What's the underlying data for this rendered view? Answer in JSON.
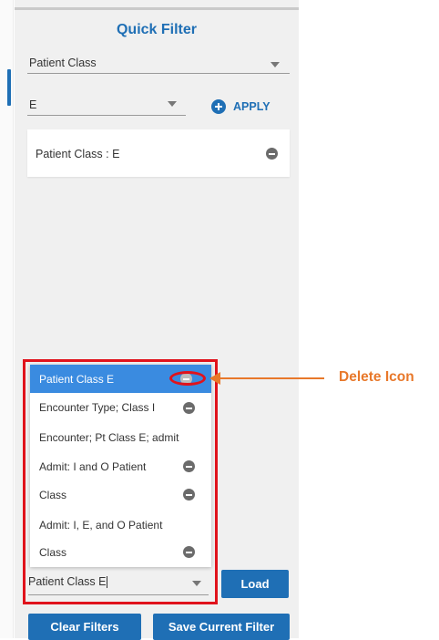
{
  "panel": {
    "title": "Quick Filter",
    "field_select": {
      "value": "Patient Class"
    },
    "value_select": {
      "value": "E"
    },
    "apply_label": "APPLY",
    "active_filters": [
      {
        "text": "Patient Class : E",
        "icon": "minus-circle-icon"
      }
    ]
  },
  "saved_filters": {
    "items": [
      {
        "label": "Patient Class E",
        "selected": true,
        "has_delete": true
      },
      {
        "label": "Encounter Type; Class I",
        "selected": false,
        "has_delete": true
      },
      {
        "label": "Encounter; Pt Class E; admit",
        "selected": false,
        "has_delete": false
      },
      {
        "label": "Admit: I and O Patient",
        "selected": false,
        "has_delete": true
      },
      {
        "label": "Class",
        "selected": false,
        "has_delete": true
      },
      {
        "label": "Admit: I, E, and O Patient",
        "selected": false,
        "has_delete": false
      },
      {
        "label": "Class",
        "selected": false,
        "has_delete": true
      }
    ],
    "input_value": "Patient Class E",
    "load_label": "Load"
  },
  "buttons": {
    "clear": "Clear Filters",
    "save": "Save Current Filter"
  },
  "annotation": {
    "label": "Delete Icon"
  },
  "colors": {
    "accent": "#1f6fb5",
    "selected": "#3a8be0",
    "annotation_red": "#e0131c",
    "annotation_orange": "#e8782a"
  }
}
